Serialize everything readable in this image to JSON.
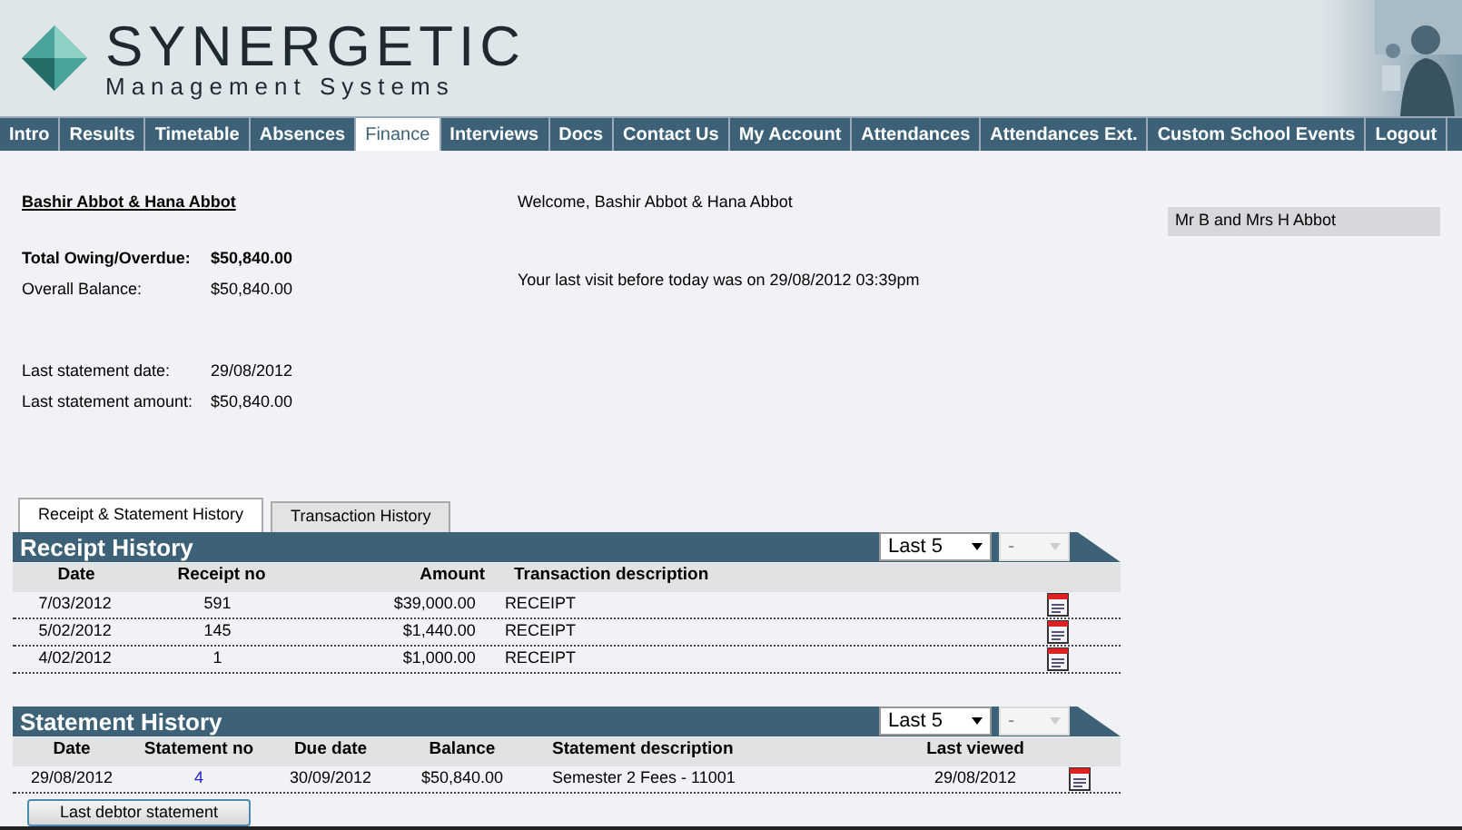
{
  "header": {
    "logo_title": "SYNERGETIC",
    "logo_subtitle": "Management Systems"
  },
  "nav": [
    {
      "label": "Intro",
      "selected": false
    },
    {
      "label": "Results",
      "selected": false
    },
    {
      "label": "Timetable",
      "selected": false
    },
    {
      "label": "Absences",
      "selected": false
    },
    {
      "label": "Finance",
      "selected": true
    },
    {
      "label": "Interviews",
      "selected": false
    },
    {
      "label": "Docs",
      "selected": false
    },
    {
      "label": "Contact Us",
      "selected": false
    },
    {
      "label": "My Account",
      "selected": false
    },
    {
      "label": "Attendances",
      "selected": false
    },
    {
      "label": "Attendances Ext.",
      "selected": false
    },
    {
      "label": "Custom School Events",
      "selected": false
    },
    {
      "label": "Logout",
      "selected": false
    }
  ],
  "account": {
    "name": "Bashir Abbot & Hana Abbot",
    "total_label": "Total Owing/Overdue:",
    "total_value": "$50,840.00",
    "balance_label": "Overall Balance:",
    "balance_value": "$50,840.00",
    "stmt_date_label": "Last statement date:",
    "stmt_date_value": "29/08/2012",
    "stmt_amount_label": "Last statement amount:",
    "stmt_amount_value": "$50,840.00"
  },
  "welcome": "Welcome, Bashir Abbot & Hana Abbot",
  "last_visit": "Your last visit before today was on 29/08/2012 03:39pm",
  "side_box": "Mr B and Mrs H Abbot",
  "tabs": [
    {
      "label": "Receipt & Statement History",
      "selected": true
    },
    {
      "label": "Transaction History",
      "selected": false
    }
  ],
  "receipt_history": {
    "title": "Receipt History",
    "filter": "Last 5",
    "filter2": {
      "value": "-",
      "disabled": true
    },
    "columns": [
      "Date",
      "Receipt no",
      "Amount",
      "Transaction description"
    ],
    "rows": [
      [
        "7/03/2012",
        "591",
        "$39,000.00",
        "RECEIPT"
      ],
      [
        "5/02/2012",
        "145",
        "$1,440.00",
        "RECEIPT"
      ],
      [
        "4/02/2012",
        "1",
        "$1,000.00",
        "RECEIPT"
      ]
    ]
  },
  "statement_history": {
    "title": "Statement History",
    "filter": "Last 5",
    "filter2": {
      "value": "-",
      "disabled": true
    },
    "columns": [
      "Date",
      "Statement no",
      "Due date",
      "Balance",
      "Statement description",
      "Last viewed"
    ],
    "rows": [
      [
        "29/08/2012",
        "4",
        "30/09/2012",
        "$50,840.00",
        "Semester 2 Fees - 11001",
        "29/08/2012"
      ]
    ]
  },
  "button": "Last debtor statement"
}
